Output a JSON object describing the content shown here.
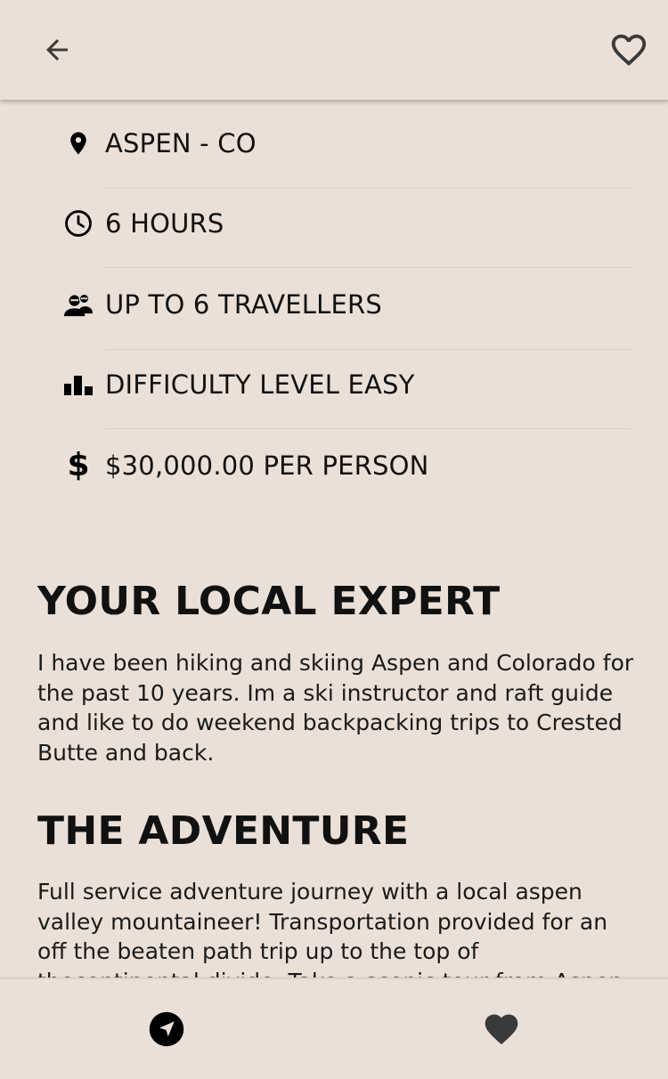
{
  "header": {
    "back_icon": "arrow-left-icon",
    "favorite_icon": "heart-outline-icon"
  },
  "details": [
    {
      "icon": "location-pin-icon",
      "text": "ASPEN - CO"
    },
    {
      "icon": "clock-icon",
      "text": "6 HOURS"
    },
    {
      "icon": "travellers-icon",
      "text": "UP TO 6 TRAVELLERS"
    },
    {
      "icon": "difficulty-bars-icon",
      "text": "DIFFICULTY LEVEL EASY"
    },
    {
      "icon": "dollar-icon",
      "text": "$30,000.00 PER PERSON"
    }
  ],
  "local_expert": {
    "title": "YOUR LOCAL EXPERT",
    "body": "I have been hiking and skiing Aspen and Colorado for the past 10 years. Im a ski instructor and raft guide and like to do weekend backpacking trips to Crested Butte and back."
  },
  "adventure": {
    "title": "THE ADVENTURE",
    "body": "Full service adventure journey with a local aspen valley mountaineer! Transportation provided for an off the beaten path trip up to the top of thecontinental divide. Take a scenic tour from Aspen and stop at a"
  },
  "bottom_nav": {
    "items": [
      {
        "icon": "navigation-arrow-icon"
      },
      {
        "icon": "heart-filled-icon"
      }
    ]
  },
  "colors": {
    "background": "#ebe0d8",
    "text": "#111111",
    "icon": "#3a3a3a"
  }
}
